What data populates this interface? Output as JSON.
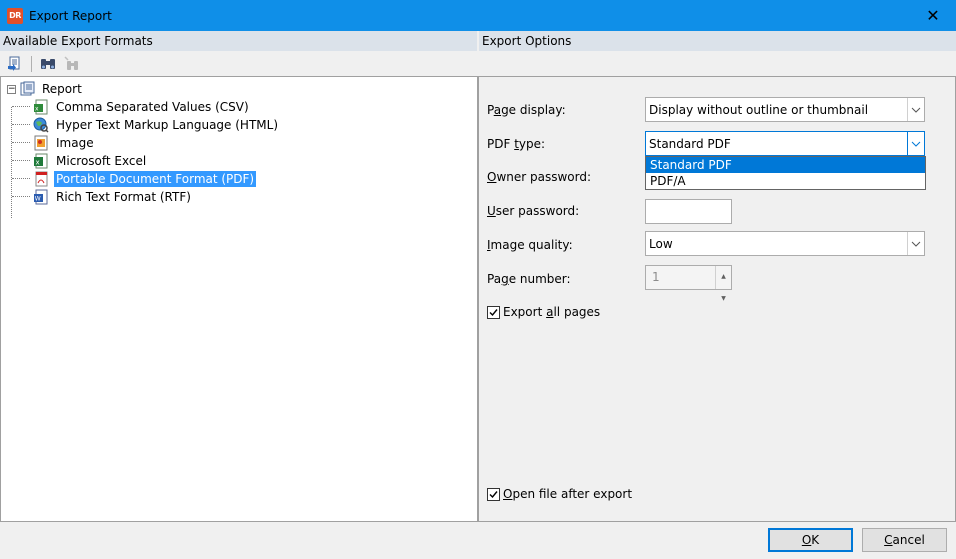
{
  "window": {
    "title": "Export Report",
    "app_icon_text": "DR",
    "close_glyph": "✕"
  },
  "left_panel": {
    "header": "Available Export Formats",
    "tree": {
      "root": {
        "label": "Report",
        "expander": "⊟"
      },
      "items": [
        {
          "label": "Comma Separated Values (CSV)",
          "icon": "csv-icon",
          "selected": false
        },
        {
          "label": "Hyper Text Markup Language (HTML)",
          "icon": "html-globe-icon",
          "selected": false
        },
        {
          "label": "Image",
          "icon": "image-icon",
          "selected": false
        },
        {
          "label": "Microsoft Excel",
          "icon": "excel-icon",
          "selected": false
        },
        {
          "label": "Portable Document Format (PDF)",
          "icon": "pdf-icon",
          "selected": true
        },
        {
          "label": "Rich Text Format (RTF)",
          "icon": "rtf-word-icon",
          "selected": false
        }
      ]
    }
  },
  "right_panel": {
    "header": "Export Options",
    "page_display": {
      "label_pre": "P",
      "label_u": "a",
      "label_post": "ge display:",
      "value": "Display without outline or thumbnail"
    },
    "pdf_type": {
      "label_pre": "PDF ",
      "label_u": "t",
      "label_post": "ype:",
      "value": "Standard PDF",
      "options": [
        "Standard PDF",
        "PDF/A"
      ],
      "selected_option": "Standard PDF"
    },
    "owner_password": {
      "label_pre": "",
      "label_u": "O",
      "label_post": "wner password:"
    },
    "user_password": {
      "label_pre": "",
      "label_u": "U",
      "label_post": "ser password:"
    },
    "image_quality": {
      "label_pre": "",
      "label_u": "I",
      "label_post": "mage quality:",
      "value": "Low"
    },
    "page_number": {
      "label_pre": "Pa",
      "label_u": "g",
      "label_post": "e number:",
      "value": "1"
    },
    "export_all_pages": {
      "label_pre": "Export ",
      "label_u": "a",
      "label_post": "ll pages",
      "checked": true
    },
    "open_after_export": {
      "label_pre": "",
      "label_u": "O",
      "label_post": "pen file after export",
      "checked": true
    }
  },
  "buttons": {
    "ok": {
      "label_u": "O",
      "label_post": "K"
    },
    "cancel": {
      "label_u": "C",
      "label_post": "ancel"
    }
  },
  "colors": {
    "titlebar": "#0f8fe8",
    "selection": "#3399ff",
    "accent": "#0078d7",
    "panel_header": "#dbe2ea"
  }
}
